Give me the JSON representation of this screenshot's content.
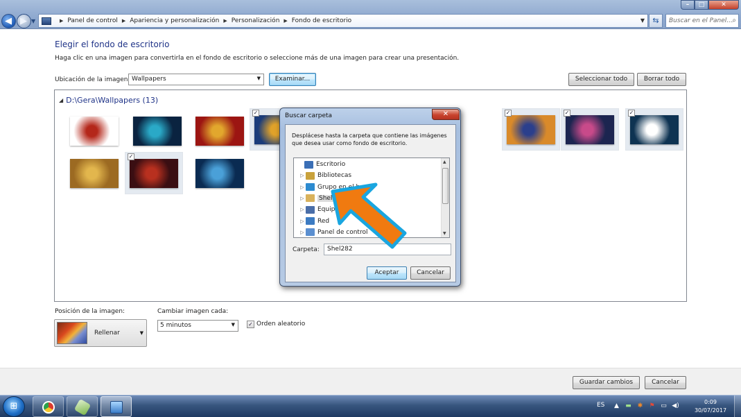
{
  "address": {
    "crumbs": [
      "Panel de control",
      "Apariencia y personalización",
      "Personalización",
      "Fondo de escritorio"
    ],
    "search_placeholder": "Buscar en el Panel..."
  },
  "page": {
    "title": "Elegir el fondo de escritorio",
    "subtitle": "Haga clic en una imagen para convertirla en el fondo de escritorio o seleccione más de una imagen para crear una presentación.",
    "location_label": "Ubicación de la imagen:",
    "location_value": "Wallpapers",
    "browse_label": "Examinar...",
    "select_all_label": "Seleccionar todo",
    "clear_all_label": "Borrar todo",
    "folder_heading": "D:\\Gera\\Wallpapers (13)"
  },
  "thumbnails": [
    {
      "checked": false,
      "selected": false,
      "c1": "#ffffff",
      "c2": "#b4271a"
    },
    {
      "checked": false,
      "selected": false,
      "c1": "#0a2340",
      "c2": "#2aa9c7"
    },
    {
      "checked": false,
      "selected": false,
      "c1": "#9c1512",
      "c2": "#e2a72d"
    },
    {
      "checked": true,
      "selected": true,
      "c1": "#1b3c7a",
      "c2": "#e0a22a"
    },
    {
      "checked": false,
      "selected": false,
      "c1": "#3a2a4a",
      "c2": "#c9a08a"
    },
    {
      "checked": true,
      "selected": true,
      "c1": "#d98a2a",
      "c2": "#2b3f8c"
    },
    {
      "checked": true,
      "selected": true,
      "c1": "#1c2550",
      "c2": "#c84a8a"
    },
    {
      "checked": true,
      "selected": true,
      "c1": "#0e3352",
      "c2": "#ffffff"
    },
    {
      "checked": false,
      "selected": false,
      "c1": "#9c6a22",
      "c2": "#e2b64d"
    },
    {
      "checked": true,
      "selected": true,
      "c1": "#3a0e12",
      "c2": "#b8301f"
    },
    {
      "checked": false,
      "selected": false,
      "c1": "#0a2b52",
      "c2": "#4aa0d8"
    }
  ],
  "dialog": {
    "title": "Buscar carpeta",
    "description": "Desplácese hasta la carpeta que contiene las imágenes que desea usar como fondo de escritorio.",
    "tree": [
      {
        "label": "Escritorio",
        "icon": "desktop-icon",
        "expandable": false,
        "indent": 0,
        "selected": false,
        "color": "#3b6fb6"
      },
      {
        "label": "Bibliotecas",
        "icon": "libraries-icon",
        "expandable": true,
        "indent": 1,
        "selected": false,
        "color": "#c9a23c"
      },
      {
        "label": "Grupo en el hogar",
        "icon": "homegroup-icon",
        "expandable": true,
        "indent": 1,
        "selected": false,
        "color": "#2d8bd0"
      },
      {
        "label": "Shel282",
        "icon": "user-folder-icon",
        "expandable": true,
        "indent": 1,
        "selected": true,
        "color": "#d9b25c"
      },
      {
        "label": "Equipo",
        "icon": "computer-icon",
        "expandable": true,
        "indent": 1,
        "selected": false,
        "color": "#4a6ea8"
      },
      {
        "label": "Red",
        "icon": "network-icon",
        "expandable": true,
        "indent": 1,
        "selected": false,
        "color": "#3c7bc2"
      },
      {
        "label": "Panel de control",
        "icon": "control-panel-icon",
        "expandable": true,
        "indent": 1,
        "selected": false,
        "color": "#5b8fd0"
      }
    ],
    "folder_label": "Carpeta:",
    "folder_value": "Shel282",
    "accept_label": "Aceptar",
    "cancel_label": "Cancelar"
  },
  "options": {
    "position_label": "Posición de la imagen:",
    "position_value": "Rellenar",
    "interval_label": "Cambiar imagen cada:",
    "interval_value": "5 minutos",
    "shuffle_checked": true,
    "shuffle_label": "Orden aleatorio"
  },
  "footer": {
    "save_label": "Guardar cambios",
    "cancel_label": "Cancelar"
  },
  "taskbar": {
    "language": "ES",
    "time": "0:09",
    "date": "30/07/2017"
  }
}
